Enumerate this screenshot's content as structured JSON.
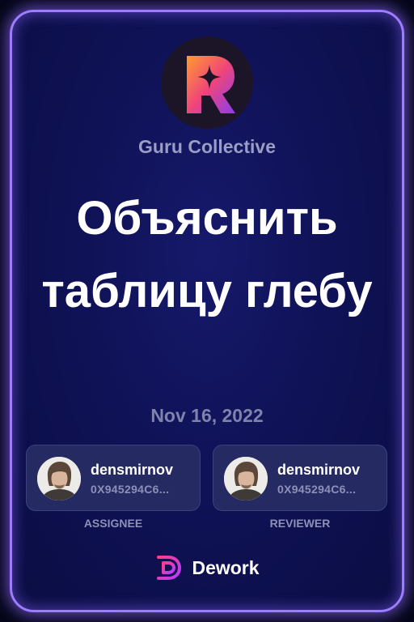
{
  "organization": {
    "logo_letter": "R",
    "name": "Guru Collective"
  },
  "task": {
    "title": "Объяснить таблицу глебу",
    "date": "Nov 16, 2022"
  },
  "assignee": {
    "username": "densmirnov",
    "address": "0X945294C6...",
    "role_label": "ASSIGNEE"
  },
  "reviewer": {
    "username": "densmirnov",
    "address": "0X945294C6...",
    "role_label": "REVIEWER"
  },
  "brand": {
    "name": "Dework"
  },
  "colors": {
    "card_border": "#9d7cff",
    "card_background": "#0f1256",
    "logo_gradient": [
      "#ff9b2f",
      "#f0457a",
      "#8a3df0"
    ],
    "dework_gradient": [
      "#ff3d8a",
      "#b53cff"
    ]
  },
  "icons": {
    "org_logo": "r-star-logo",
    "avatar": "user-photo-avatar",
    "brand_logo": "dework-d-logo"
  }
}
